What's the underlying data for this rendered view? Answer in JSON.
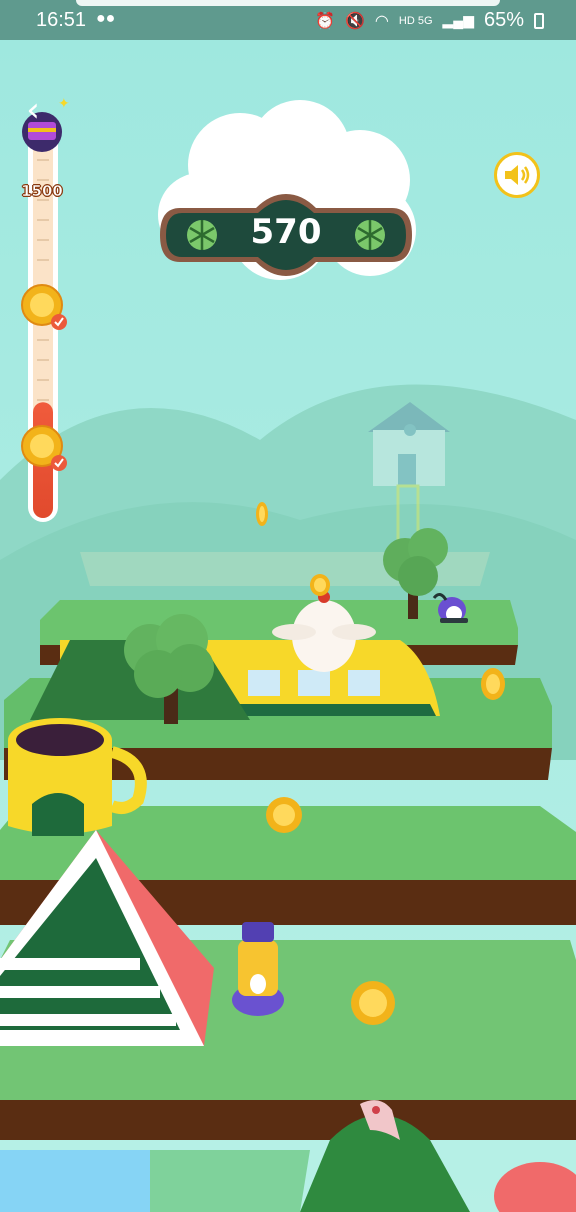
{
  "status_bar": {
    "time": "16:51",
    "network": "HD 5G",
    "battery": "65%"
  },
  "header": {
    "back_icon": "chevron-left-icon",
    "sound_icon": "speaker-icon"
  },
  "score": {
    "value": "570",
    "icon": "cabbage-icon"
  },
  "progress": {
    "top_reward_label": "1500",
    "milestones": [
      {
        "icon": "crown-coin-icon",
        "claimed": true
      },
      {
        "icon": "crown-coin-icon",
        "claimed": true
      }
    ],
    "fill_fraction": 0.3
  },
  "colors": {
    "accent": "#f2c21a",
    "panel": "#1e4a3c",
    "progress_fill": "#ec5a3a",
    "grass": "#6cc46e"
  }
}
